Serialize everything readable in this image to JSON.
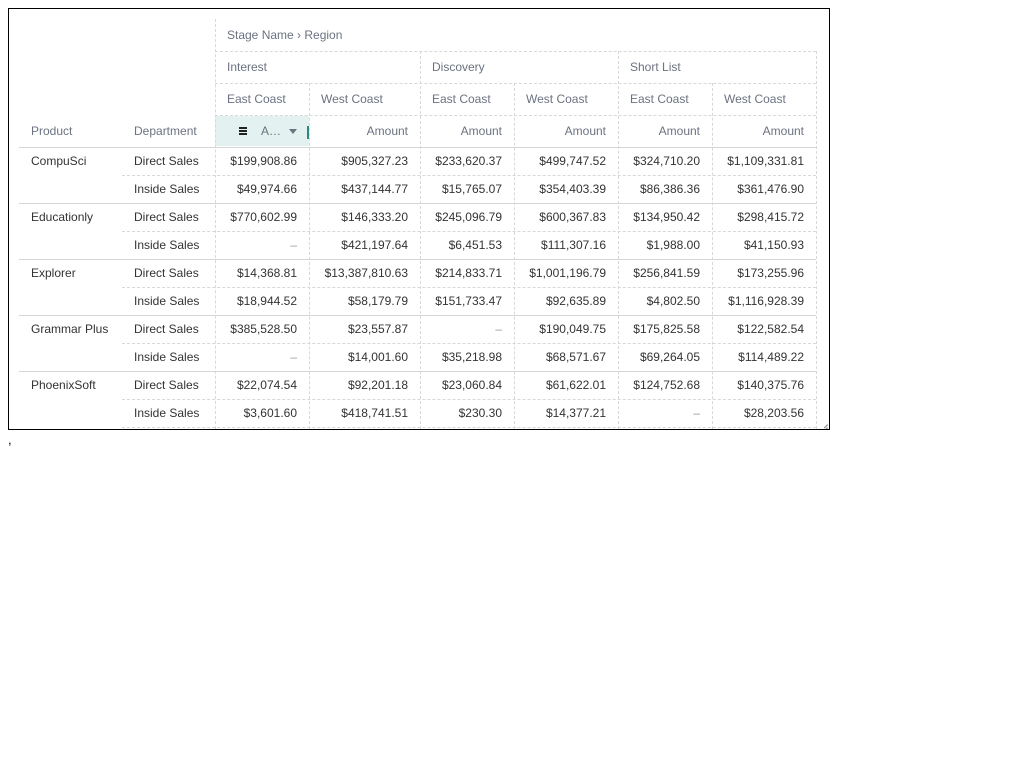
{
  "header": {
    "title": "Stage Name › Region",
    "row_dims": [
      "Product",
      "Department"
    ],
    "stages": [
      "Interest",
      "Discovery",
      "Short List"
    ],
    "regions": [
      "East Coast",
      "West Coast",
      "East Coast",
      "West Coast",
      "East Coast",
      "West Coast"
    ],
    "measures": [
      "A…",
      "Amount",
      "Amount",
      "Amount",
      "Amount",
      "Amount"
    ]
  },
  "rows": [
    {
      "product": "CompuSci",
      "department": "Direct Sales",
      "values": [
        "$199,908.86",
        "$905,327.23",
        "$233,620.37",
        "$499,747.52",
        "$324,710.20",
        "$1,109,331.81"
      ]
    },
    {
      "product": "",
      "department": "Inside Sales",
      "values": [
        "$49,974.66",
        "$437,144.77",
        "$15,765.07",
        "$354,403.39",
        "$86,386.36",
        "$361,476.90"
      ]
    },
    {
      "product": "Educationly",
      "department": "Direct Sales",
      "values": [
        "$770,602.99",
        "$146,333.20",
        "$245,096.79",
        "$600,367.83",
        "$134,950.42",
        "$298,415.72"
      ]
    },
    {
      "product": "",
      "department": "Inside Sales",
      "values": [
        "–",
        "$421,197.64",
        "$6,451.53",
        "$111,307.16",
        "$1,988.00",
        "$41,150.93"
      ]
    },
    {
      "product": "Explorer",
      "department": "Direct Sales",
      "values": [
        "$14,368.81",
        "$13,387,810.63",
        "$214,833.71",
        "$1,001,196.79",
        "$256,841.59",
        "$173,255.96"
      ]
    },
    {
      "product": "",
      "department": "Inside Sales",
      "values": [
        "$18,944.52",
        "$58,179.79",
        "$151,733.47",
        "$92,635.89",
        "$4,802.50",
        "$1,116,928.39"
      ]
    },
    {
      "product": "Grammar Plus",
      "department": "Direct Sales",
      "values": [
        "$385,528.50",
        "$23,557.87",
        "–",
        "$190,049.75",
        "$175,825.58",
        "$122,582.54"
      ]
    },
    {
      "product": "",
      "department": "Inside Sales",
      "values": [
        "–",
        "$14,001.60",
        "$35,218.98",
        "$68,571.67",
        "$69,264.05",
        "$114,489.22"
      ]
    },
    {
      "product": "PhoenixSoft",
      "department": "Direct Sales",
      "values": [
        "$22,074.54",
        "$92,201.18",
        "$23,060.84",
        "$61,622.01",
        "$124,752.68",
        "$140,375.76"
      ]
    },
    {
      "product": "",
      "department": "Inside Sales",
      "values": [
        "$3,601.60",
        "$418,741.51",
        "$230.30",
        "$14,377.21",
        "–",
        "$28,203.56"
      ]
    }
  ],
  "footer": {
    "stray_text": ","
  },
  "colors": {
    "accent": "#2a8a7e",
    "selected_bg": "#e3f1f0",
    "grid": "#d8d8d8"
  }
}
